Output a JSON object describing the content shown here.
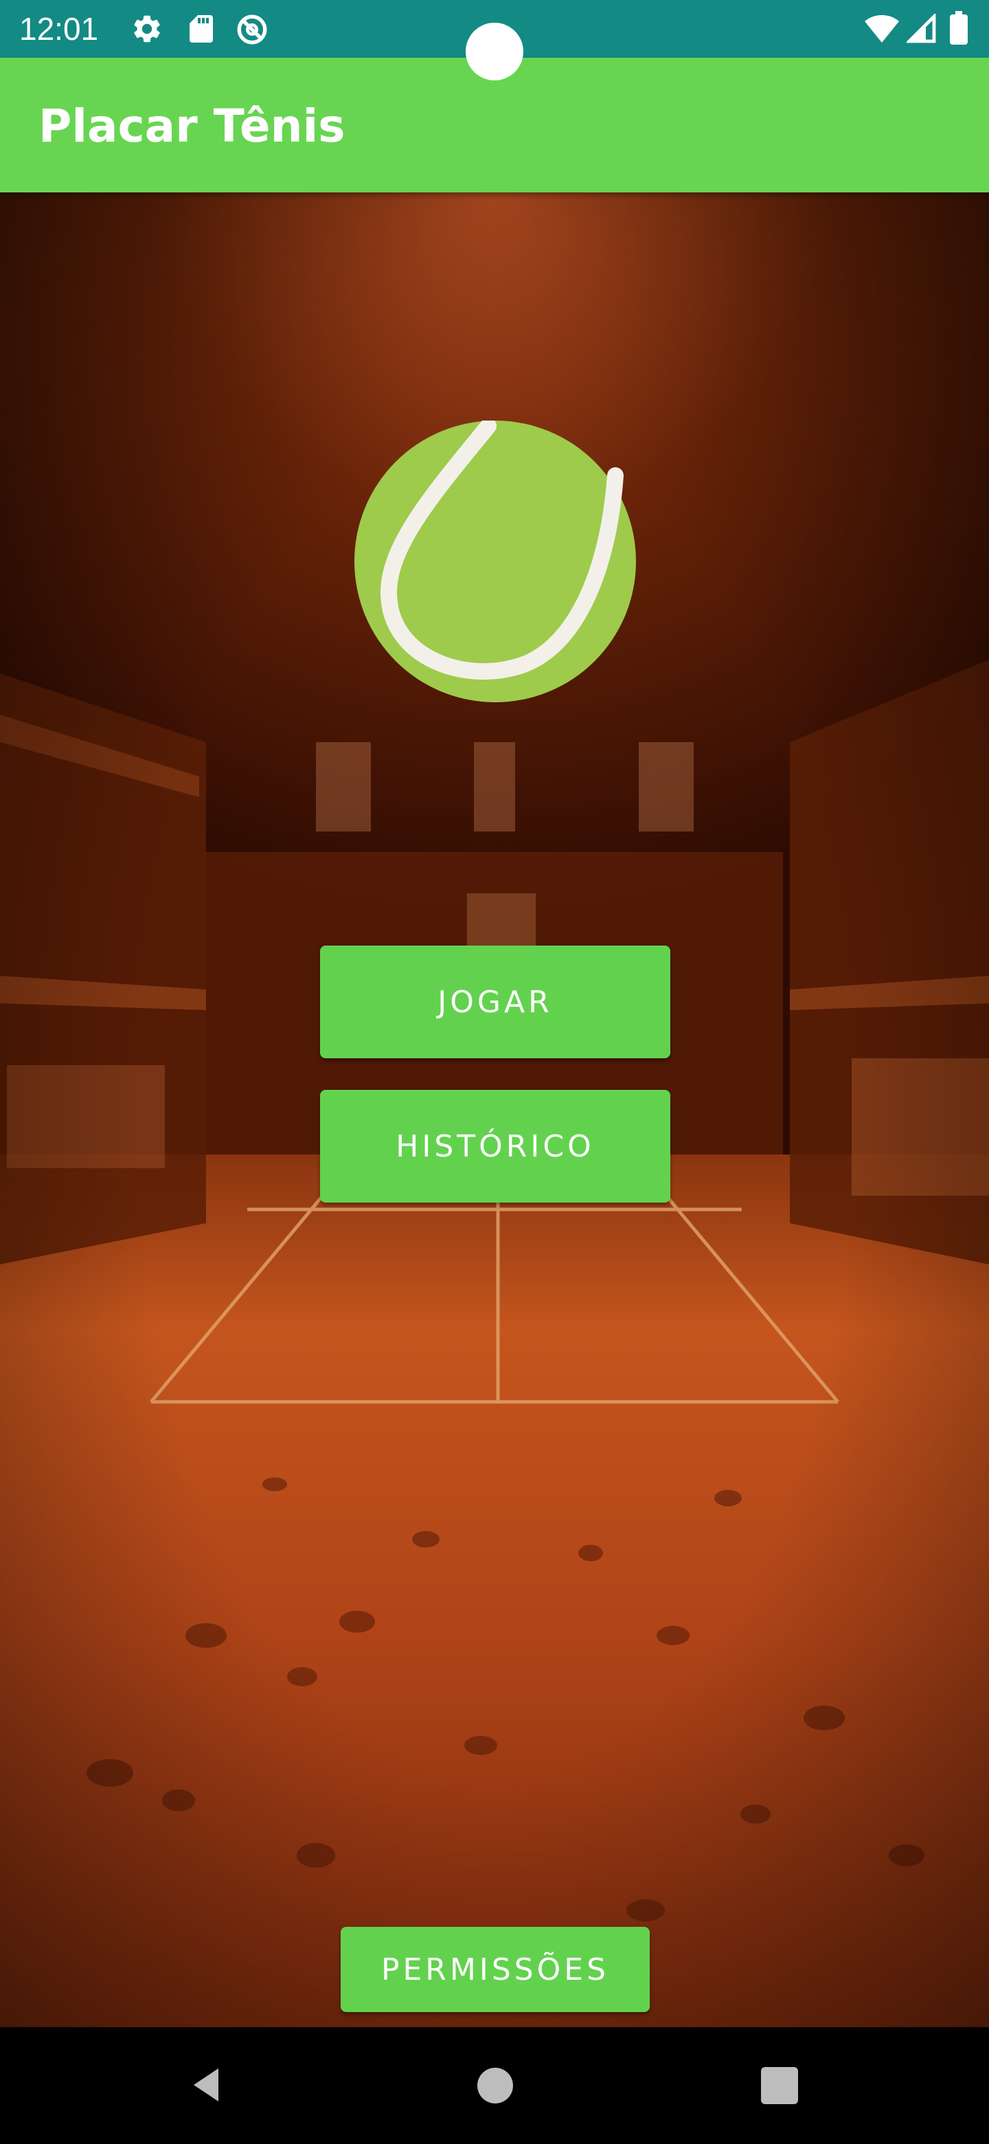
{
  "status_bar": {
    "time": "12:01",
    "icons_left": [
      "gear-icon",
      "sd-card-icon",
      "data-saver-icon"
    ],
    "icons_right": [
      "wifi-icon",
      "signal-icon",
      "battery-icon"
    ],
    "background_color": "#148a84"
  },
  "app_bar": {
    "title": "Placar Tênis",
    "background_color": "#68d552"
  },
  "main": {
    "logo_icon": "tennis-ball-icon",
    "background_image": "clay-tennis-court",
    "buttons": {
      "play_label": "JOGAR",
      "history_label": "HISTÓRICO",
      "permissions_label": "PERMISSÕES"
    },
    "button_color": "#62d24e"
  },
  "nav_bar": {
    "buttons": [
      "back-icon",
      "home-icon",
      "recents-icon"
    ]
  }
}
